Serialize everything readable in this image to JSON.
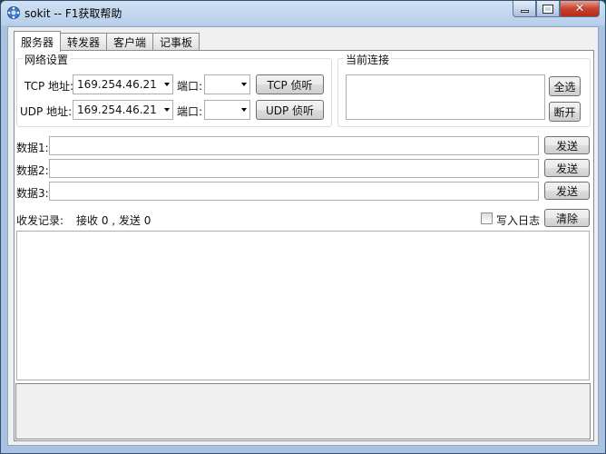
{
  "window": {
    "title": "sokit -- F1获取帮助"
  },
  "tabs": [
    {
      "label": "服务器",
      "active": true
    },
    {
      "label": "转发器",
      "active": false
    },
    {
      "label": "客户端",
      "active": false
    },
    {
      "label": "记事板",
      "active": false
    }
  ],
  "network": {
    "group_label": "网络设置",
    "tcp_addr_label": "TCP 地址:",
    "tcp_addr_value": "169.254.46.21",
    "udp_addr_label": "UDP 地址:",
    "udp_addr_value": "169.254.46.21",
    "port_label": "端口:",
    "tcp_port_value": "",
    "udp_port_value": "",
    "tcp_listen_button": "TCP 侦听",
    "udp_listen_button": "UDP 侦听"
  },
  "connections": {
    "group_label": "当前连接",
    "select_all_button": "全选",
    "disconnect_button": "断开"
  },
  "data_rows": [
    {
      "label": "数据1:",
      "value": "",
      "send_button": "发送"
    },
    {
      "label": "数据2:",
      "value": "",
      "send_button": "发送"
    },
    {
      "label": "数据3:",
      "value": "",
      "send_button": "发送"
    }
  ],
  "log": {
    "label": "收发记录:",
    "stats": "接收 0 , 发送 0",
    "write_log_label": "写入日志",
    "write_log_checked": false,
    "clear_button": "清除"
  }
}
